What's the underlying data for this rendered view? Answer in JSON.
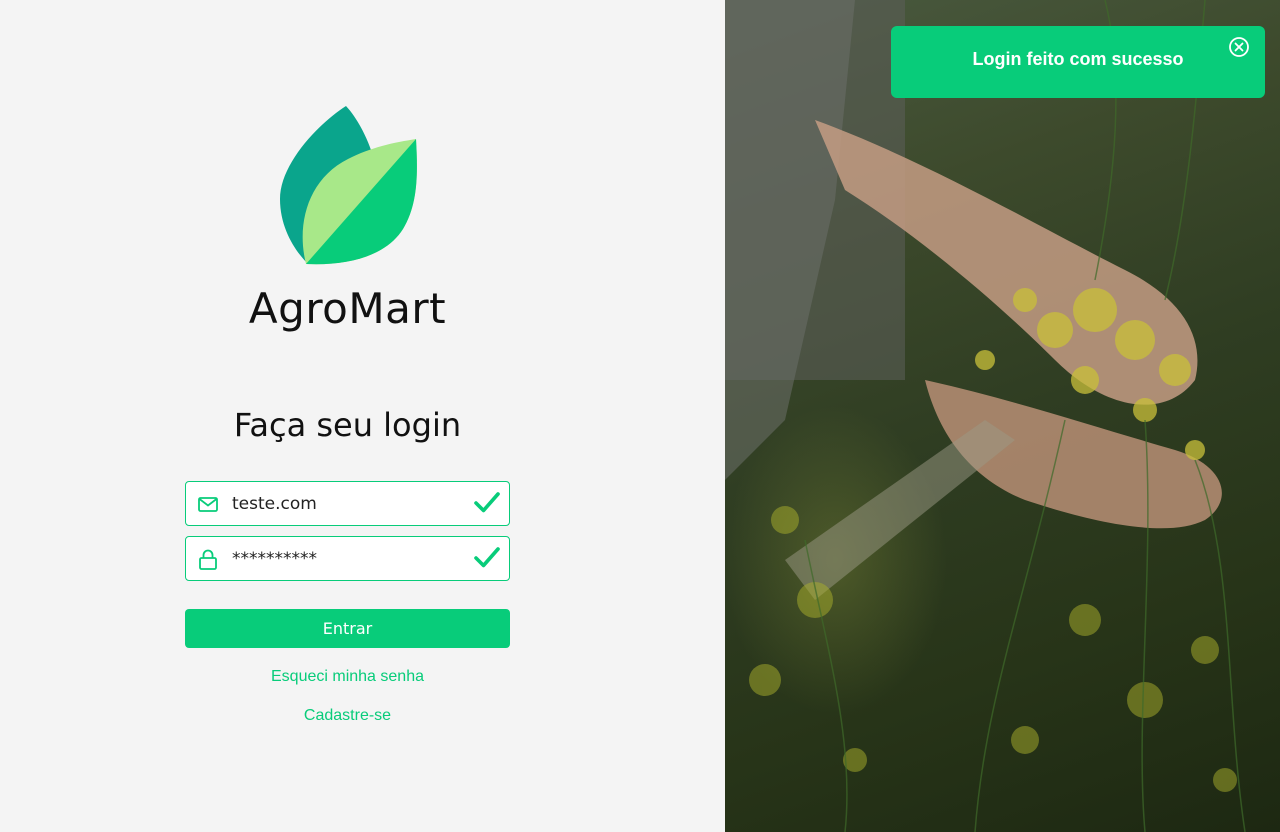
{
  "brand": {
    "name": "AgroMart"
  },
  "form": {
    "heading": "Faça seu login",
    "email_value": "teste.com",
    "password_value": "**********",
    "submit_label": "Entrar",
    "forgot_link": "Esqueci minha senha",
    "signup_link": "Cadastre-se"
  },
  "toast": {
    "message": "Login feito com sucesso"
  },
  "colors": {
    "accent": "#08cc7a",
    "leaf_dark": "#0aa58c",
    "leaf_light": "#a8e889"
  },
  "icons": {
    "email": "mail-icon",
    "password": "lock-icon",
    "valid": "check-icon",
    "close": "close-circle-icon"
  }
}
